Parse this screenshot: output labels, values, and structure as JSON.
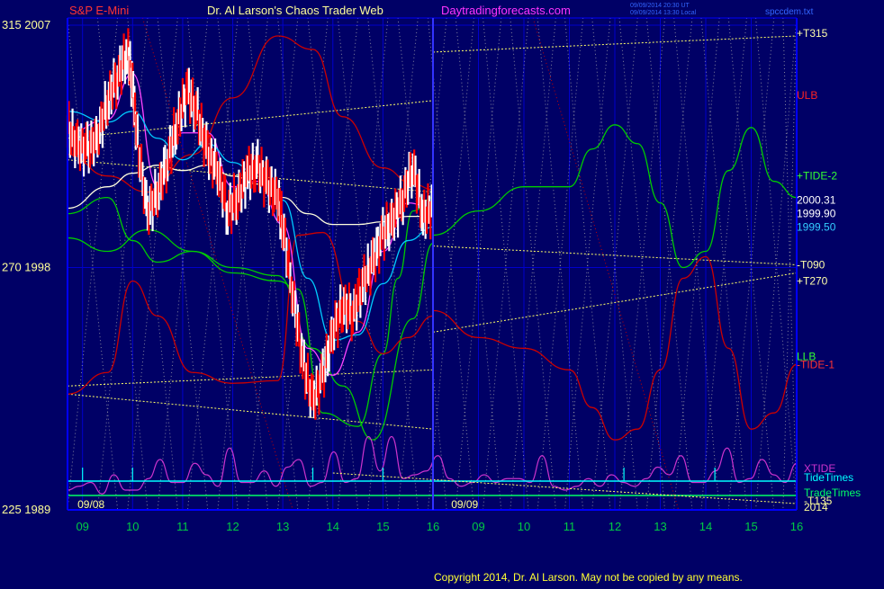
{
  "header": {
    "symbol": "S&P E-Mini",
    "site_title": "Dr. Al Larson's Chaos Trader Web",
    "url": "Daytradingforecasts.com",
    "timestamp_utc": "09/09/2014 20:30 UT",
    "timestamp_local": "09/09/2014 13:30 Local",
    "lib_label": "spccdem.txt"
  },
  "footer": {
    "copyright": "Copyright 2014, Dr. Al Larson. May not be copied by any means."
  },
  "colors": {
    "background": "#000066",
    "axes": "#0000ff",
    "grid": "#0000cc",
    "price_up": "#ffffff",
    "price_down": "#ff0000",
    "tide_neg": "#cc0000",
    "tide_pos": "#00cc00",
    "ma_fast": "#ff44ff",
    "ma_cyan": "#00ccff",
    "ma_slow": "#ffffdd",
    "xtide": "#cc33cc",
    "tide_times": "#00ffff",
    "trade_times": "#00ff66",
    "yellow_lines": "#ffff66",
    "grey_diagonals": "#b0b0b0",
    "text_yellow": "#ffff99",
    "x_ticks_green": "#00cc44"
  },
  "chart_data": {
    "type": "line",
    "title": "S&P E-Mini",
    "ylim": [
      1989,
      2007
    ],
    "ylabels": [
      {
        "text": "315  2007",
        "value": 2007
      },
      {
        "text": "270  1998",
        "value": 1998
      },
      {
        "text": "225  1989",
        "value": 1989
      }
    ],
    "xlim": [
      8.7,
      16.0
    ],
    "xlim_forecast": [
      16.0,
      24.0
    ],
    "now_x": 16.0,
    "x_ticks": [
      {
        "label": "09",
        "x": 9
      },
      {
        "label": "10",
        "x": 10
      },
      {
        "label": "11",
        "x": 11
      },
      {
        "label": "12",
        "x": 12
      },
      {
        "label": "13",
        "x": 13
      },
      {
        "label": "14",
        "x": 14
      },
      {
        "label": "15",
        "x": 15
      },
      {
        "label": "16",
        "x": 16
      },
      {
        "label": "09",
        "x": 17
      },
      {
        "label": "10",
        "x": 18
      },
      {
        "label": "11",
        "x": 19
      },
      {
        "label": "12",
        "x": 20
      },
      {
        "label": "13",
        "x": 21
      },
      {
        "label": "14",
        "x": 22
      },
      {
        "label": "15",
        "x": 23
      },
      {
        "label": "16",
        "x": 24
      }
    ],
    "date_labels": [
      {
        "text": "09/08",
        "x": 8.9
      },
      {
        "text": "09/09",
        "x": 16.4
      }
    ],
    "price_series": {
      "x": [
        8.7,
        8.9,
        9.1,
        9.3,
        9.5,
        9.7,
        9.9,
        10.0,
        10.1,
        10.3,
        10.5,
        10.7,
        10.9,
        11.1,
        11.3,
        11.5,
        11.7,
        11.9,
        12.1,
        12.3,
        12.5,
        12.7,
        12.9,
        13.0,
        13.2,
        13.4,
        13.6,
        13.8,
        14.0,
        14.2,
        14.4,
        14.6,
        14.8,
        15.0,
        15.2,
        15.4,
        15.6,
        15.8,
        16.0
      ],
      "y": [
        2003.2,
        2002.5,
        2002.4,
        2002.8,
        2004.2,
        2005.1,
        2006.0,
        2004.7,
        2002.6,
        2000.0,
        2000.8,
        2002.0,
        2003.4,
        2004.6,
        2003.6,
        2002.3,
        2001.6,
        2000.1,
        2000.6,
        2001.5,
        2001.7,
        2001.1,
        2000.6,
        1999.6,
        1997.0,
        1994.5,
        1993.0,
        1994.0,
        1995.6,
        1996.6,
        1996.3,
        1997.4,
        1998.2,
        1999.2,
        1999.8,
        2000.6,
        2001.8,
        1999.9,
        2000.2
      ]
    },
    "series": [
      {
        "name": "ULB",
        "x": [
          8.7,
          9.5,
          10.3,
          11.2,
          12.0,
          12.9,
          13.6,
          14.2,
          15.0,
          15.6,
          16.0
        ],
        "y": [
          2002.2,
          2001.4,
          2000.8,
          2002.2,
          2004.3,
          2006.6,
          2006.1,
          2003.6,
          2001.7,
          2001.1,
          2000.9
        ]
      },
      {
        "name": "LLB",
        "x": [
          8.7,
          9.5,
          10.3,
          11.2,
          12.0,
          12.9,
          13.6,
          14.2,
          14.8,
          15.6,
          16.0
        ],
        "y": [
          1999.1,
          1998.6,
          1999.4,
          1998.6,
          1998.0,
          1997.7,
          1995.0,
          1993.6,
          1991.6,
          1996.1,
          1998.9
        ]
      },
      {
        "name": "+TIDE-2",
        "x": [
          8.7,
          9.5,
          10.0,
          10.5,
          11.2,
          12.0,
          12.9,
          13.3,
          13.8,
          14.5,
          15.0,
          15.3,
          15.6,
          16.0
        ],
        "y": [
          2000.0,
          2000.6,
          1999.0,
          1998.2,
          1998.6,
          1997.8,
          1997.5,
          1997.2,
          1992.6,
          1992.1,
          1994.8,
          1997.6,
          2000.1,
          2000.6
        ]
      },
      {
        "name": "-TIDE-1",
        "x": [
          8.7,
          9.5,
          10.0,
          10.5,
          11.2,
          12.0,
          12.9,
          13.3,
          13.8,
          14.5,
          15.0,
          15.5,
          16.0
        ],
        "y": [
          1993.3,
          1994.1,
          1997.5,
          1996.2,
          1994.1,
          1993.7,
          1993.8,
          1999.2,
          1999.3,
          1996.0,
          1994.8,
          1995.4,
          1996.2
        ]
      },
      {
        "name": "MA fast",
        "x": [
          8.7,
          9.5,
          10.0,
          10.5,
          11.0,
          11.5,
          12.0,
          12.5,
          13.0,
          13.5,
          14.0,
          14.5,
          15.0,
          15.5,
          16.0
        ],
        "y": [
          2003.0,
          2003.5,
          2005.2,
          2001.0,
          2003.0,
          2003.0,
          2001.0,
          2001.2,
          1999.6,
          1995.0,
          1994.0,
          1995.6,
          1998.6,
          2000.4,
          2000.2
        ]
      },
      {
        "name": "MA cyan",
        "x": [
          8.7,
          9.5,
          10.0,
          10.5,
          11.0,
          11.5,
          12.0,
          12.5,
          13.0,
          13.5,
          14.0,
          14.5,
          15.0,
          15.5,
          16.0
        ],
        "y": [
          2003.8,
          2003.4,
          2003.8,
          2002.8,
          2002.0,
          2002.6,
          2001.9,
          2001.4,
          2000.5,
          1997.6,
          1995.3,
          1995.5,
          1997.4,
          1999.0,
          1999.5
        ]
      },
      {
        "name": "MA slow",
        "x": [
          8.7,
          9.5,
          10.0,
          10.5,
          11.0,
          11.5,
          12.0,
          12.5,
          13.0,
          13.5,
          14.0,
          14.5,
          15.0,
          15.5,
          16.0
        ],
        "y": [
          2000.2,
          2001.0,
          2001.5,
          2001.8,
          2001.6,
          2001.8,
          2001.4,
          2001.1,
          2000.6,
          2000.0,
          1999.6,
          1999.6,
          1999.7,
          1999.9,
          1999.9
        ]
      },
      {
        "name": "ULB fc",
        "x": [
          16.0,
          17.0,
          18.0,
          19.0,
          19.5,
          20.0,
          20.5,
          21.0,
          21.5,
          22.0,
          22.5,
          23.0,
          23.5,
          24.0
        ],
        "y": [
          1996.4,
          1995.4,
          1995.0,
          1994.2,
          1992.8,
          1991.6,
          1992.0,
          1994.2,
          1997.6,
          1998.4,
          1995.0,
          1992.0,
          1992.6,
          1994.4
        ]
      },
      {
        "name": "LLB fc",
        "x": [
          16.0,
          17.0,
          18.0,
          19.0,
          19.5,
          20.0,
          20.5,
          21.0,
          21.5,
          22.0,
          22.5,
          23.0,
          23.5,
          24.0
        ],
        "y": [
          1999.2,
          2000.1,
          2001.0,
          2001.0,
          2002.4,
          2003.3,
          2002.6,
          2000.4,
          1998.0,
          1998.6,
          2001.6,
          2003.2,
          2001.2,
          2000.6
        ]
      }
    ],
    "level_lines": [
      {
        "label": "+T315",
        "x": [
          16.0,
          24.0
        ],
        "y": [
          2006.0,
          2006.6
        ]
      },
      {
        "label": "-T090",
        "x": [
          16.0,
          24.0
        ],
        "y": [
          1998.8,
          1998.1
        ]
      },
      {
        "label": "+T270",
        "x": [
          16.0,
          24.0
        ],
        "y": [
          1995.6,
          1997.8
        ]
      },
      {
        "label": "past1",
        "x": [
          8.7,
          16.0
        ],
        "y": [
          2002.8,
          2004.2
        ]
      },
      {
        "label": "past2",
        "x": [
          8.7,
          16.0
        ],
        "y": [
          2002.0,
          2000.8
        ]
      },
      {
        "label": "past3",
        "x": [
          8.7,
          16.0
        ],
        "y": [
          1993.6,
          1994.2
        ]
      },
      {
        "label": "past4",
        "x": [
          8.7,
          16.0
        ],
        "y": [
          1993.3,
          1992.0
        ]
      }
    ],
    "right_labels": [
      {
        "text": "+T315",
        "value": 2006.7,
        "color": "#ffffaa"
      },
      {
        "text": "ULB",
        "value": 2004.4,
        "color": "#ff2222"
      },
      {
        "text": "+TIDE-2",
        "value": 2001.4,
        "color": "#33ff33"
      },
      {
        "text": "2000.31",
        "value": 2000.5,
        "color": "#ffffff"
      },
      {
        "text": "1999.90",
        "value": 2000.0,
        "color": "#ffffff"
      },
      {
        "text": "1999.50",
        "value": 1999.5,
        "color": "#33ccff"
      },
      {
        "text": "-T090",
        "value": 1998.1,
        "color": "#ffffaa"
      },
      {
        "text": "+T270",
        "value": 1997.5,
        "color": "#ffffaa"
      },
      {
        "text": "LLB",
        "value": 1994.7,
        "color": "#33ff33"
      },
      {
        "text": "-TIDE-1",
        "value": 1994.4,
        "color": "#ff3333"
      }
    ],
    "lower_panel": {
      "xtide_label": "XTIDE",
      "tide_times_label": "TideTimes",
      "trade_times_label": "TradeTimes",
      "t_extra": "-T135",
      "t_extra2": "2014",
      "xtide_y": [
        0.2,
        0.25,
        0.3,
        0.15,
        0.4,
        0.2,
        0.2,
        0.35,
        0.6,
        0.3,
        0.3,
        0.55,
        0.4,
        0.25,
        0.75,
        0.3,
        0.3,
        0.45,
        0.25,
        0.5,
        0.6,
        0.25,
        0.3,
        0.7,
        0.3,
        0.35,
        0.9,
        0.45,
        0.9,
        0.35,
        0.4,
        0.45,
        0.65,
        0.35,
        0.25,
        0.3,
        0.4,
        0.3,
        0.35,
        0.35,
        0.3,
        0.65,
        0.25,
        0.2,
        0.25,
        0.35,
        0.25,
        0.4,
        0.3,
        0.25,
        0.35,
        0.5,
        0.4,
        0.65,
        0.3,
        0.3,
        0.45,
        0.75,
        0.3,
        0.35,
        0.6,
        0.4,
        0.3,
        0.55
      ]
    }
  }
}
